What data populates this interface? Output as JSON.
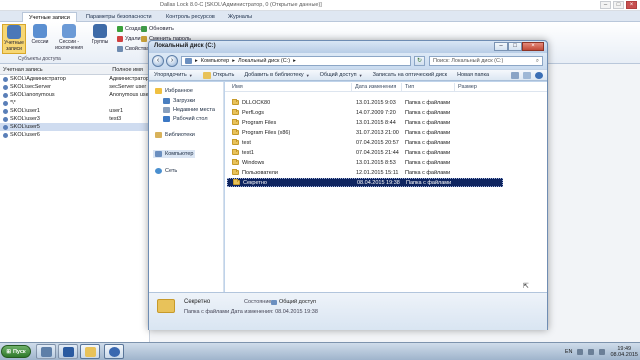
{
  "bg_app": {
    "title": "Dallas Lock 8.0-C [SKOL\\Администратор, 0 (Открытые данные)]",
    "tabs": [
      "Учетные записи",
      "Параметры безопасности",
      "Контроль ресурсов",
      "Журналы"
    ],
    "ribbon": {
      "big_buttons": [
        "Учетные записи",
        "Сессии",
        "Сессии - исключения",
        "Группы"
      ],
      "small_buttons": [
        "Создать",
        "Удалить",
        "Свойства",
        "Обновить",
        "Сменить пароль"
      ],
      "group_label": "Субъекты доступа"
    },
    "table": {
      "headers": [
        "Учетная запись",
        "Полное имя"
      ],
      "rows": [
        {
          "name": "SKOL\\Администратор",
          "full": "Администратор"
        },
        {
          "name": "SKOL\\secServer",
          "full": "secServer user"
        },
        {
          "name": "SKOL\\anonymous",
          "full": "Anonymous user"
        },
        {
          "name": "*\\*",
          "full": ""
        },
        {
          "name": "SKOL\\user1",
          "full": "user1"
        },
        {
          "name": "SKOL\\user3",
          "full": "test3"
        },
        {
          "name": "SKOL\\user5",
          "full": ""
        },
        {
          "name": "SKOL\\user6",
          "full": ""
        }
      ],
      "selected_index": 6
    }
  },
  "explorer": {
    "title": "Локальный диск (C:)",
    "address_parts": [
      "Компьютер",
      "Локальный диск (C:)"
    ],
    "search_placeholder": "Поиск: Локальный диск (C:)",
    "toolbar": [
      "Упорядочить",
      "Открыть",
      "Добавить в библиотеку",
      "Общий доступ",
      "Записать на оптический диск",
      "Новая папка"
    ],
    "nav": {
      "favorites": "Избранное",
      "favorites_items": [
        "Загрузки",
        "Недавние места",
        "Рабочий стол"
      ],
      "libraries": "Библиотеки",
      "computer": "Компьютер",
      "network": "Сеть"
    },
    "columns": [
      "Имя",
      "Дата изменения",
      "Тип",
      "Размер"
    ],
    "files": [
      {
        "name": "DLLOCK80",
        "date": "13.01.2015 9:03",
        "type": "Папка с файлами"
      },
      {
        "name": "PerfLogs",
        "date": "14.07.2009 7:20",
        "type": "Папка с файлами"
      },
      {
        "name": "Program Files",
        "date": "13.01.2015 8:44",
        "type": "Папка с файлами"
      },
      {
        "name": "Program Files (x86)",
        "date": "31.07.2013 21:00",
        "type": "Папка с файлами"
      },
      {
        "name": "test",
        "date": "07.04.2015 20:57",
        "type": "Папка с файлами"
      },
      {
        "name": "test1",
        "date": "07.04.2015 21:44",
        "type": "Папка с файлами"
      },
      {
        "name": "Windows",
        "date": "13.01.2015 8:53",
        "type": "Папка с файлами"
      },
      {
        "name": "Пользователи",
        "date": "12.01.2015 15:11",
        "type": "Папка с файлами"
      },
      {
        "name": "Секретно",
        "date": "08.04.2015 19:38",
        "type": "Папка с файлами"
      }
    ],
    "selected_file": "Секретно",
    "details": {
      "name": "Секретно",
      "state_label": "Состояние:",
      "state_value": "Общий доступ",
      "sub": "Папка с файлами Дата изменения: 08.04.2015 19:38"
    }
  },
  "taskbar": {
    "start_label": "Пуск",
    "lang": "EN",
    "time": "19:49",
    "date": "08.04.2015"
  }
}
